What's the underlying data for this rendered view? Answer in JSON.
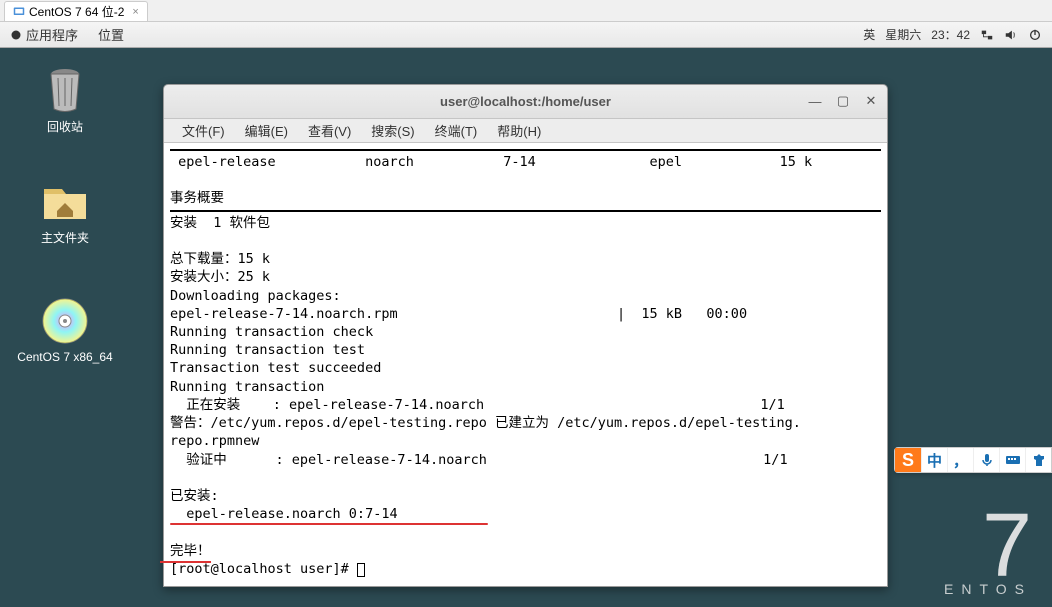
{
  "vm_tab": {
    "label": "CentOS 7 64 位-2",
    "close": "×"
  },
  "topbar": {
    "apps": "应用程序",
    "places": "位置",
    "lang": "英",
    "day": "星期六",
    "time": "23：42"
  },
  "desktop_icons": {
    "trash": "回收站",
    "home": "主文件夹",
    "disc": "CentOS 7 x86_64"
  },
  "terminal": {
    "title": "user@localhost:/home/user",
    "menus": {
      "file": "文件(F)",
      "edit": "编辑(E)",
      "view": "查看(V)",
      "search": "搜索(S)",
      "terminal": "终端(T)",
      "help": "帮助(H)"
    },
    "header_line": " epel-release           noarch           7-14              epel            15 k",
    "summary_header": "事务概要",
    "install_count": "安装  1 软件包",
    "dl_total": "总下载量：15 k",
    "install_size": "安装大小：25 k",
    "downloading": "Downloading packages:",
    "rpm_line": "epel-release-7-14.noarch.rpm                           |  15 kB   00:00",
    "rt_check": "Running transaction check",
    "rt_test": "Running transaction test",
    "tt_succeed": "Transaction test succeeded",
    "rt_run": "Running transaction",
    "installing": "  正在安装    : epel-release-7-14.noarch                                  1/1",
    "warning": "警告：/etc/yum.repos.d/epel-testing.repo 已建立为 /etc/yum.repos.d/epel-testing.",
    "warning2": "repo.rpmnew",
    "verifying": "  验证中      : epel-release-7-14.noarch                                  1/1",
    "installed_header": "已安装:",
    "installed_pkg": "  epel-release.noarch 0:7-14",
    "done": "完毕！",
    "prompt": "[root@localhost user]# "
  },
  "centos_mark": {
    "big": "7",
    "label": "ENTOS"
  },
  "ime": {
    "zh": "中",
    "comma": "，"
  }
}
